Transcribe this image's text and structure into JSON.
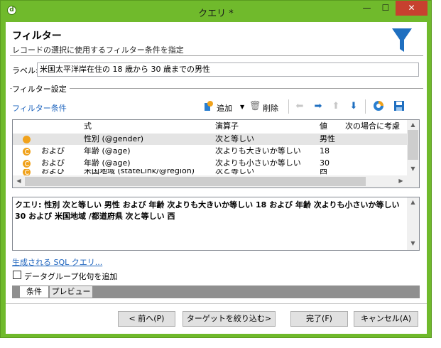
{
  "window": {
    "title": "クエリ *",
    "app_icon_glyph": "d",
    "minimize_glyph": "—",
    "maximize_glyph": "☐",
    "close_glyph": "✕"
  },
  "header": {
    "title": "フィルター",
    "subtitle": "レコードの選択に使用するフィルター条件を指定",
    "icon": "filter-funnel-icon",
    "icon_color": "#1f6fc0"
  },
  "label_field": {
    "label": "ラベル:",
    "value": "米国太平洋岸在住の 18 歳から 30 歳までの男性"
  },
  "filter_settings": {
    "group_title": "フィルター設定",
    "toolbar": {
      "title": "フィルター条件",
      "add_label": "追加",
      "delete_label": "削除"
    },
    "columns": [
      "式",
      "演算子",
      "値",
      "次の場合に考慮"
    ],
    "rows": [
      {
        "conj": "",
        "expr": "性別 (@gender)",
        "op": "次と等しい",
        "val": "男性",
        "selected": true
      },
      {
        "conj": "および",
        "expr": "年齢 (@age)",
        "op": "次よりも大きいか等しい",
        "val": "18"
      },
      {
        "conj": "および",
        "expr": "年齢 (@age)",
        "op": "次よりも小さいか等しい",
        "val": "30"
      },
      {
        "conj": "および",
        "expr": "米国地域 (stateLink/@region)",
        "op": "次と等しい",
        "val": "西"
      }
    ]
  },
  "query_text": "クエリ: 性別 次と等しい 男性 および 年齢 次よりも大きいか等しい 18 および 年齢 次よりも小さいか等しい 30 および 米国地域 /都道府県 次と等しい 西",
  "sql_link": "生成される SQL クエリ...",
  "group_by_checkbox": {
    "label": "データグループ化句を追加",
    "checked": false
  },
  "tabs": [
    "条件",
    "プレビュー"
  ],
  "buttons": {
    "back": "< 前へ(P)",
    "narrow": "ターゲットを絞り込む>",
    "finish": "完了(F)",
    "cancel": "キャンセル(A)"
  },
  "colors": {
    "title_bar": "#70ba2c",
    "accent_link": "#1e64be",
    "close_button": "#c7412f"
  }
}
